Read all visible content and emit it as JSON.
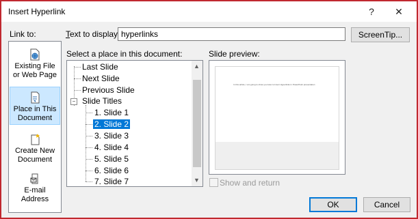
{
  "window": {
    "title": "Insert Hyperlink",
    "help_glyph": "?",
    "close_glyph": "✕"
  },
  "link_to": {
    "label": "Link to:",
    "items": [
      {
        "line1": "Existing File",
        "line2": "or Web Page",
        "icon": "web-page-file-icon",
        "selected": false
      },
      {
        "line1": "Place in This",
        "line2": "Document",
        "icon": "document-place-icon",
        "selected": true
      },
      {
        "line1": "Create New",
        "line2": "Document",
        "icon": "new-document-icon",
        "selected": false
      },
      {
        "line1": "E-mail",
        "line2": "Address",
        "icon": "email-address-icon",
        "selected": false
      }
    ]
  },
  "text_to_display": {
    "label": "Text to display:",
    "value": "hyperlinks"
  },
  "screentip_button": "ScreenTip...",
  "place_section": {
    "label": "Select a place in this document:",
    "items": [
      {
        "text": "Last Slide"
      },
      {
        "text": "Next Slide"
      },
      {
        "text": "Previous Slide"
      },
      {
        "text": "Slide Titles",
        "expander": "−"
      },
      {
        "text": "1. Slide 1"
      },
      {
        "text": "2. Slide 2",
        "selected": true
      },
      {
        "text": "3. Slide 3"
      },
      {
        "text": "4. Slide 4"
      },
      {
        "text": "5. Slide 5"
      },
      {
        "text": "6. Slide 6"
      },
      {
        "text": "7. Slide 7"
      }
    ]
  },
  "preview": {
    "label": "Slide preview:",
    "slide_text": "In this article, I am going to show you How to Insert Hyperlinks in PowerPoint presentation"
  },
  "show_and_return": {
    "label": "Show and return",
    "checked": false
  },
  "buttons": {
    "ok": "OK",
    "cancel": "Cancel"
  },
  "colors": {
    "accent": "#0078d7",
    "frame_border": "#c0282f",
    "selected_nav": "#cce8ff"
  }
}
